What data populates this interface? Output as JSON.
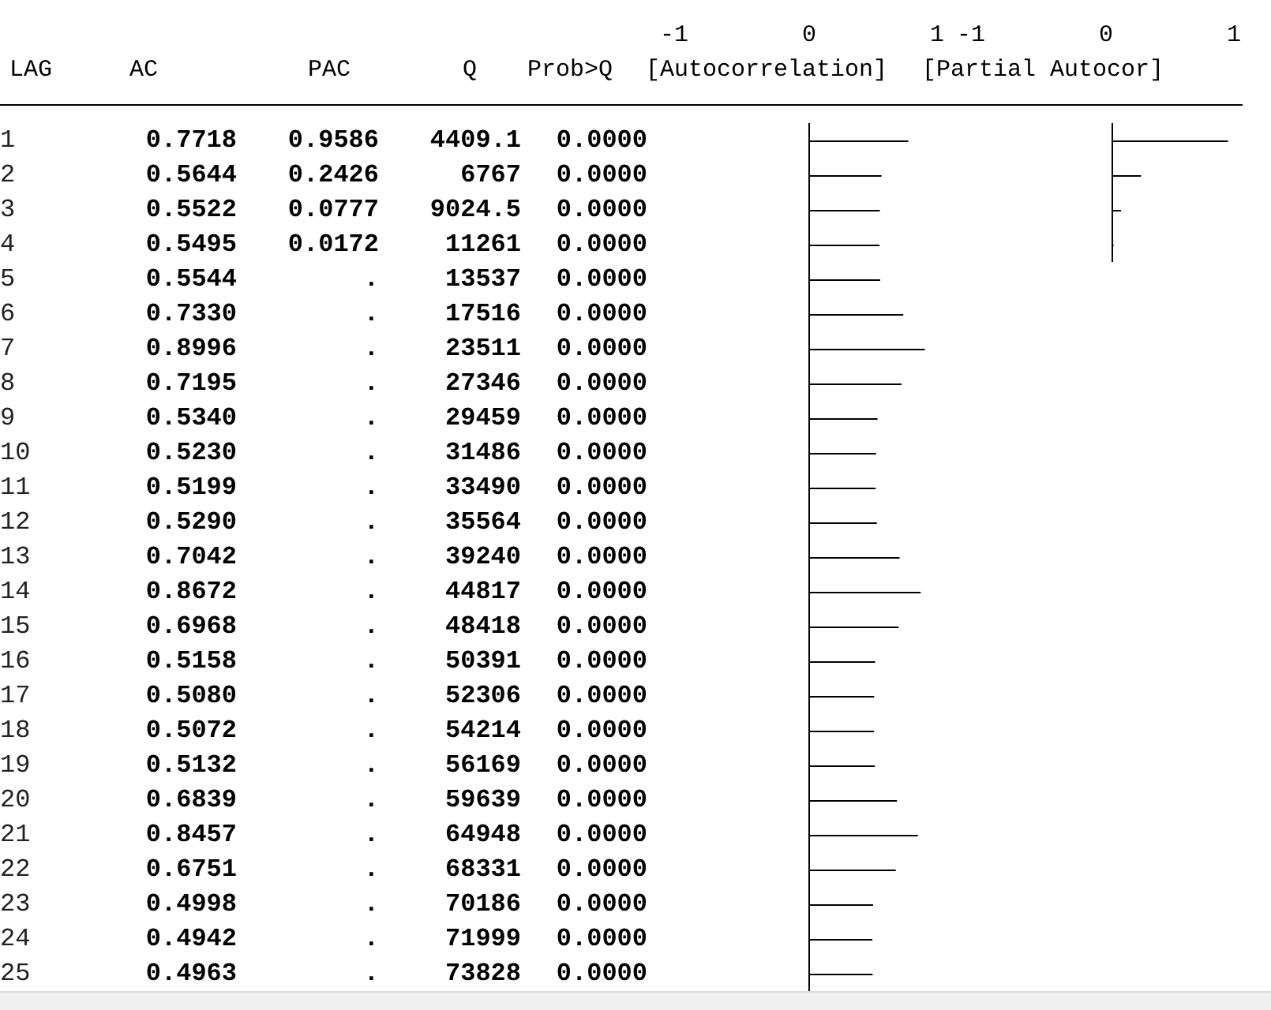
{
  "table": {
    "columns": [
      "LAG",
      "AC",
      "PAC",
      "Q",
      "Prob>Q"
    ],
    "ac_plot": {
      "title": "[Autocorrelation]",
      "ticks": [
        "-1",
        "0",
        "1"
      ]
    },
    "pac_plot": {
      "title": "[Partial Autocor]",
      "ticks": [
        "-1",
        "0",
        "1"
      ]
    },
    "rows": [
      {
        "lag": "1",
        "ac": "0.7718",
        "pac": "0.9586",
        "q": "4409.1",
        "prob": "0.0000"
      },
      {
        "lag": "2",
        "ac": "0.5644",
        "pac": "0.2426",
        "q": "6767",
        "prob": "0.0000"
      },
      {
        "lag": "3",
        "ac": "0.5522",
        "pac": "0.0777",
        "q": "9024.5",
        "prob": "0.0000"
      },
      {
        "lag": "4",
        "ac": "0.5495",
        "pac": "0.0172",
        "q": "11261",
        "prob": "0.0000"
      },
      {
        "lag": "5",
        "ac": "0.5544",
        "pac": ".",
        "q": "13537",
        "prob": "0.0000"
      },
      {
        "lag": "6",
        "ac": "0.7330",
        "pac": ".",
        "q": "17516",
        "prob": "0.0000"
      },
      {
        "lag": "7",
        "ac": "0.8996",
        "pac": ".",
        "q": "23511",
        "prob": "0.0000"
      },
      {
        "lag": "8",
        "ac": "0.7195",
        "pac": ".",
        "q": "27346",
        "prob": "0.0000"
      },
      {
        "lag": "9",
        "ac": "0.5340",
        "pac": ".",
        "q": "29459",
        "prob": "0.0000"
      },
      {
        "lag": "10",
        "ac": "0.5230",
        "pac": ".",
        "q": "31486",
        "prob": "0.0000"
      },
      {
        "lag": "11",
        "ac": "0.5199",
        "pac": ".",
        "q": "33490",
        "prob": "0.0000"
      },
      {
        "lag": "12",
        "ac": "0.5290",
        "pac": ".",
        "q": "35564",
        "prob": "0.0000"
      },
      {
        "lag": "13",
        "ac": "0.7042",
        "pac": ".",
        "q": "39240",
        "prob": "0.0000"
      },
      {
        "lag": "14",
        "ac": "0.8672",
        "pac": ".",
        "q": "44817",
        "prob": "0.0000"
      },
      {
        "lag": "15",
        "ac": "0.6968",
        "pac": ".",
        "q": "48418",
        "prob": "0.0000"
      },
      {
        "lag": "16",
        "ac": "0.5158",
        "pac": ".",
        "q": "50391",
        "prob": "0.0000"
      },
      {
        "lag": "17",
        "ac": "0.5080",
        "pac": ".",
        "q": "52306",
        "prob": "0.0000"
      },
      {
        "lag": "18",
        "ac": "0.5072",
        "pac": ".",
        "q": "54214",
        "prob": "0.0000"
      },
      {
        "lag": "19",
        "ac": "0.5132",
        "pac": ".",
        "q": "56169",
        "prob": "0.0000"
      },
      {
        "lag": "20",
        "ac": "0.6839",
        "pac": ".",
        "q": "59639",
        "prob": "0.0000"
      },
      {
        "lag": "21",
        "ac": "0.8457",
        "pac": ".",
        "q": "64948",
        "prob": "0.0000"
      },
      {
        "lag": "22",
        "ac": "0.6751",
        "pac": ".",
        "q": "68331",
        "prob": "0.0000"
      },
      {
        "lag": "23",
        "ac": "0.4998",
        "pac": ".",
        "q": "70186",
        "prob": "0.0000"
      },
      {
        "lag": "24",
        "ac": "0.4942",
        "pac": ".",
        "q": "71999",
        "prob": "0.0000"
      },
      {
        "lag": "25",
        "ac": "0.4963",
        "pac": ".",
        "q": "73828",
        "prob": "0.0000"
      }
    ]
  }
}
